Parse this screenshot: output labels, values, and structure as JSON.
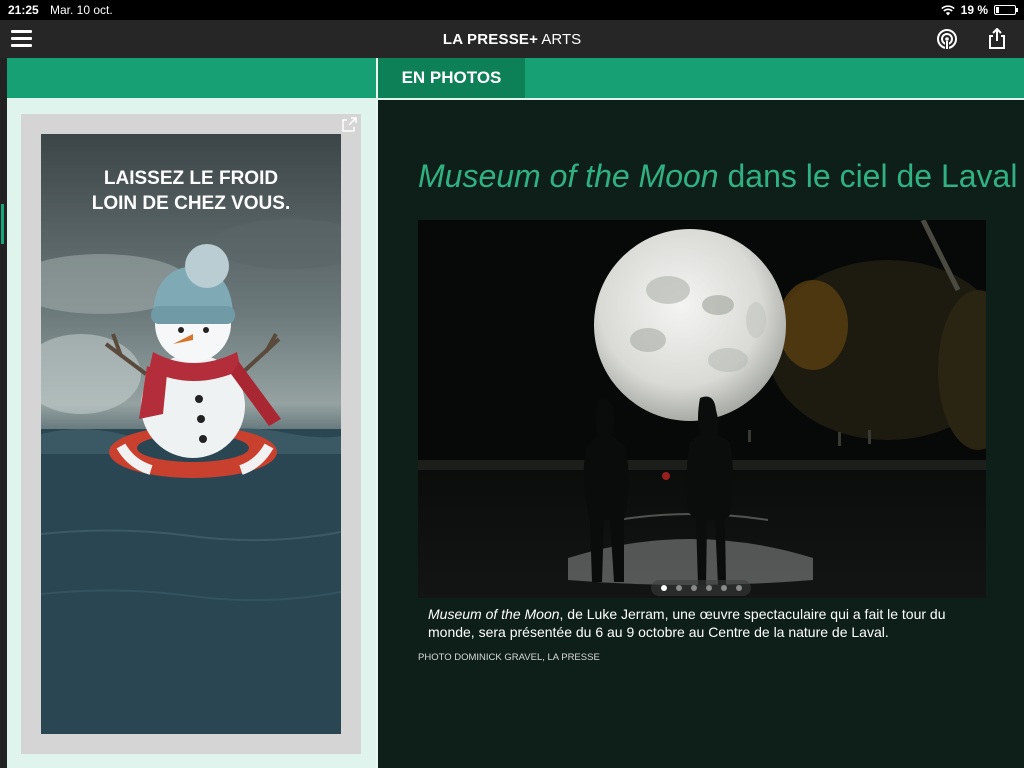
{
  "status_bar": {
    "time": "21:25",
    "date": "Mar. 10 oct.",
    "battery": "19 %",
    "battery_level": 0.19,
    "wifi_icon": "wifi-icon"
  },
  "app_header": {
    "brand": "LA PRESSE+",
    "section": "ARTS",
    "menu_icon": "hamburger-menu-icon",
    "podcast_icon": "podcast-icon",
    "share_icon": "share-icon"
  },
  "section_bar": {
    "tab_label": "EN PHOTOS",
    "accent": "#17a074",
    "tab_color": "#0e8058"
  },
  "ad": {
    "line1": "LAISSEZ LE FROID",
    "line2": "LOIN DE CHEZ VOUS.",
    "expand_icon": "external-link-icon"
  },
  "article": {
    "title_em": "Museum of the Moon",
    "title_rest": " dans le ciel de Laval",
    "title_color": "#2fb183",
    "caption_em": "Museum of the Moon",
    "caption_rest": ", de Luke Jerram, une œuvre spectaculaire qui a fait le tour du monde, sera présentée du 6 au 9 octobre au Centre de la nature de Laval.",
    "credit": "PHOTO DOMINICK GRAVEL, LA PRESSE",
    "gallery": {
      "count": 6,
      "current": 1
    }
  }
}
